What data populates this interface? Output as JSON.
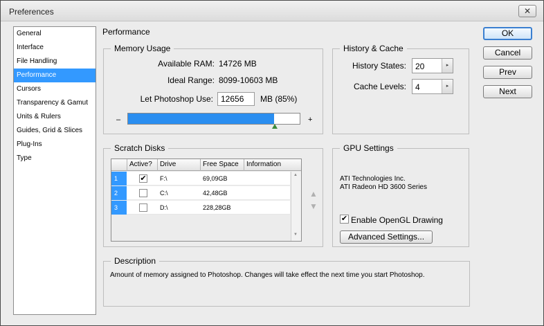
{
  "window": {
    "title": "Preferences",
    "close_glyph": "✕"
  },
  "sidebar": {
    "items": [
      {
        "label": "General"
      },
      {
        "label": "Interface"
      },
      {
        "label": "File Handling"
      },
      {
        "label": "Performance",
        "active": true
      },
      {
        "label": "Cursors"
      },
      {
        "label": "Transparency & Gamut"
      },
      {
        "label": "Units & Rulers"
      },
      {
        "label": "Guides, Grid & Slices"
      },
      {
        "label": "Plug-Ins"
      },
      {
        "label": "Type"
      }
    ]
  },
  "page_title": "Performance",
  "memory": {
    "legend": "Memory Usage",
    "available_label": "Available RAM:",
    "available_value": "14726 MB",
    "ideal_label": "Ideal Range:",
    "ideal_value": "8099-10603 MB",
    "use_label": "Let Photoshop Use:",
    "use_value": "12656",
    "use_suffix": "MB (85%)",
    "minus": "–",
    "plus": "+",
    "slider_fraction": 0.85,
    "fill_color": "#2a8ef0"
  },
  "history": {
    "legend": "History & Cache",
    "states_label": "History States:",
    "states_value": "20",
    "levels_label": "Cache Levels:",
    "levels_value": "4",
    "spin_glyph": "▸"
  },
  "scratch": {
    "legend": "Scratch Disks",
    "columns": [
      "Active?",
      "Drive",
      "Free Space",
      "Information"
    ],
    "rows": [
      {
        "num": "1",
        "active": true,
        "check": "✔",
        "drive": "F:\\",
        "free": "69,09GB",
        "info": ""
      },
      {
        "num": "2",
        "active": false,
        "check": "",
        "drive": "C:\\",
        "free": "42,48GB",
        "info": ""
      },
      {
        "num": "3",
        "active": false,
        "check": "",
        "drive": "D:\\",
        "free": "228,28GB",
        "info": ""
      }
    ],
    "scroll_up": "▲",
    "scroll_down": "▼",
    "move_up": "▲",
    "move_down": "▼"
  },
  "gpu": {
    "legend": "GPU Settings",
    "vendor": "ATI Technologies Inc.",
    "model": "ATI Radeon HD 3600 Series",
    "opengl_label": "Enable OpenGL Drawing",
    "opengl_checked": true,
    "opengl_check": "✔",
    "advanced_label": "Advanced Settings..."
  },
  "buttons": {
    "ok": "OK",
    "cancel": "Cancel",
    "prev": "Prev",
    "next": "Next"
  },
  "description": {
    "legend": "Description",
    "text": "Amount of memory assigned to Photoshop. Changes will take effect the next time you start Photoshop."
  }
}
